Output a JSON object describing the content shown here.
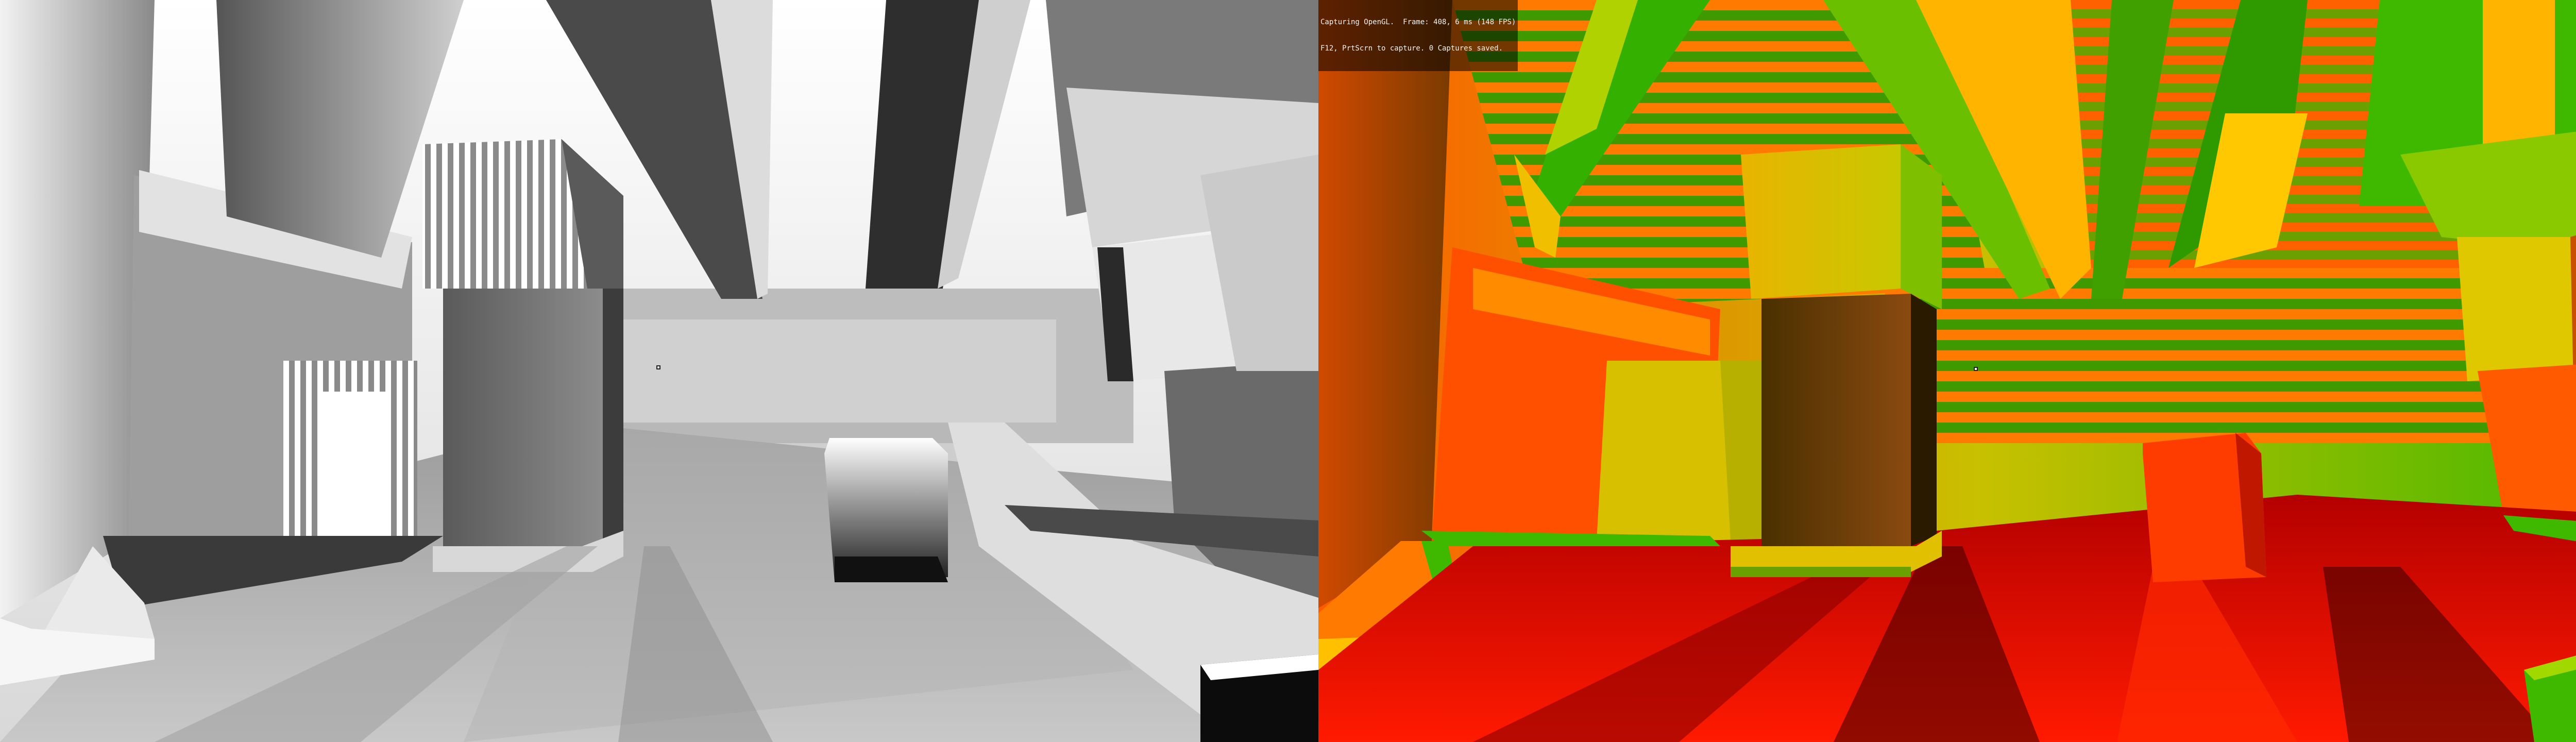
{
  "overlay": {
    "line1": "Capturing OpenGL.  Frame: 408, 6 ms (148 FPS)",
    "line2": "F12, PrtScrn to capture. 0 Captures saved."
  },
  "views": [
    {
      "id": "left",
      "label": "depth-greyscale-view",
      "palette": "greyscale"
    },
    {
      "id": "right",
      "label": "normal-color-view",
      "palette": "red-green"
    }
  ],
  "colors": {
    "grey_dark": "#3c3c3c",
    "grey_mid": "#9a9a9a",
    "grey_light": "#f0f0f0",
    "red": "#ff1a00",
    "orange": "#ff6a00",
    "yellow": "#e6c300",
    "green": "#3fb800",
    "dark_green": "#2a6e00",
    "brown": "#6a3a10"
  }
}
